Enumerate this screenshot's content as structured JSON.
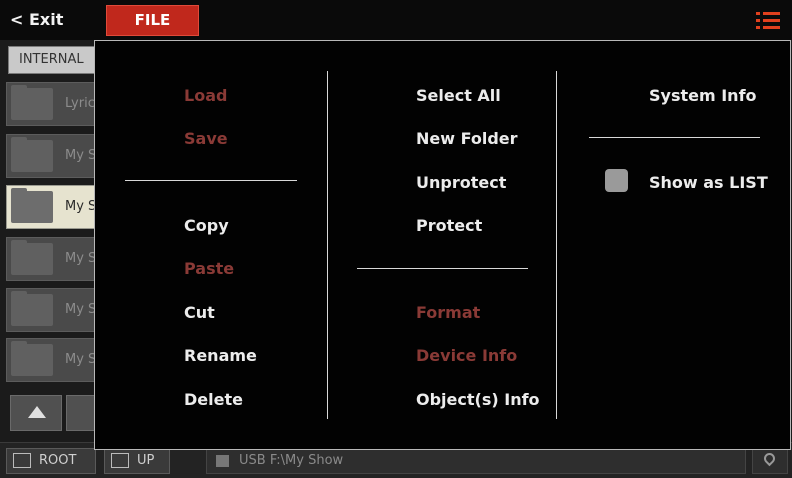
{
  "topbar": {
    "exit_label": "< Exit",
    "file_tab_label": "FILE",
    "menu_icon": "list-menu-icon"
  },
  "browser": {
    "storage_tab": "INTERNAL",
    "rows": [
      {
        "name": "Lyric",
        "selected": false
      },
      {
        "name": "My S",
        "selected": false
      },
      {
        "name": "My S",
        "selected": true
      },
      {
        "name": "My S",
        "selected": false
      },
      {
        "name": "My S",
        "selected": false
      },
      {
        "name": "My S",
        "selected": false
      }
    ]
  },
  "bottombar": {
    "root_label": "ROOT",
    "up_label": "UP",
    "path": "USB F:\\My Show"
  },
  "menu": {
    "col1": {
      "load": "Load",
      "save": "Save",
      "copy": "Copy",
      "paste": "Paste",
      "cut": "Cut",
      "rename": "Rename",
      "delete": "Delete"
    },
    "col2": {
      "select_all": "Select All",
      "new_folder": "New Folder",
      "unprotect": "Unprotect",
      "protect": "Protect",
      "format": "Format",
      "device_info": "Device Info",
      "objects_info": "Object(s) Info"
    },
    "col3": {
      "system_info": "System Info",
      "show_as_list": "Show as LIST",
      "show_as_list_checked": false
    }
  },
  "colors": {
    "accent": "#c0281c",
    "disabled_text": "#8a3a36",
    "menu_bg": "#020202"
  }
}
